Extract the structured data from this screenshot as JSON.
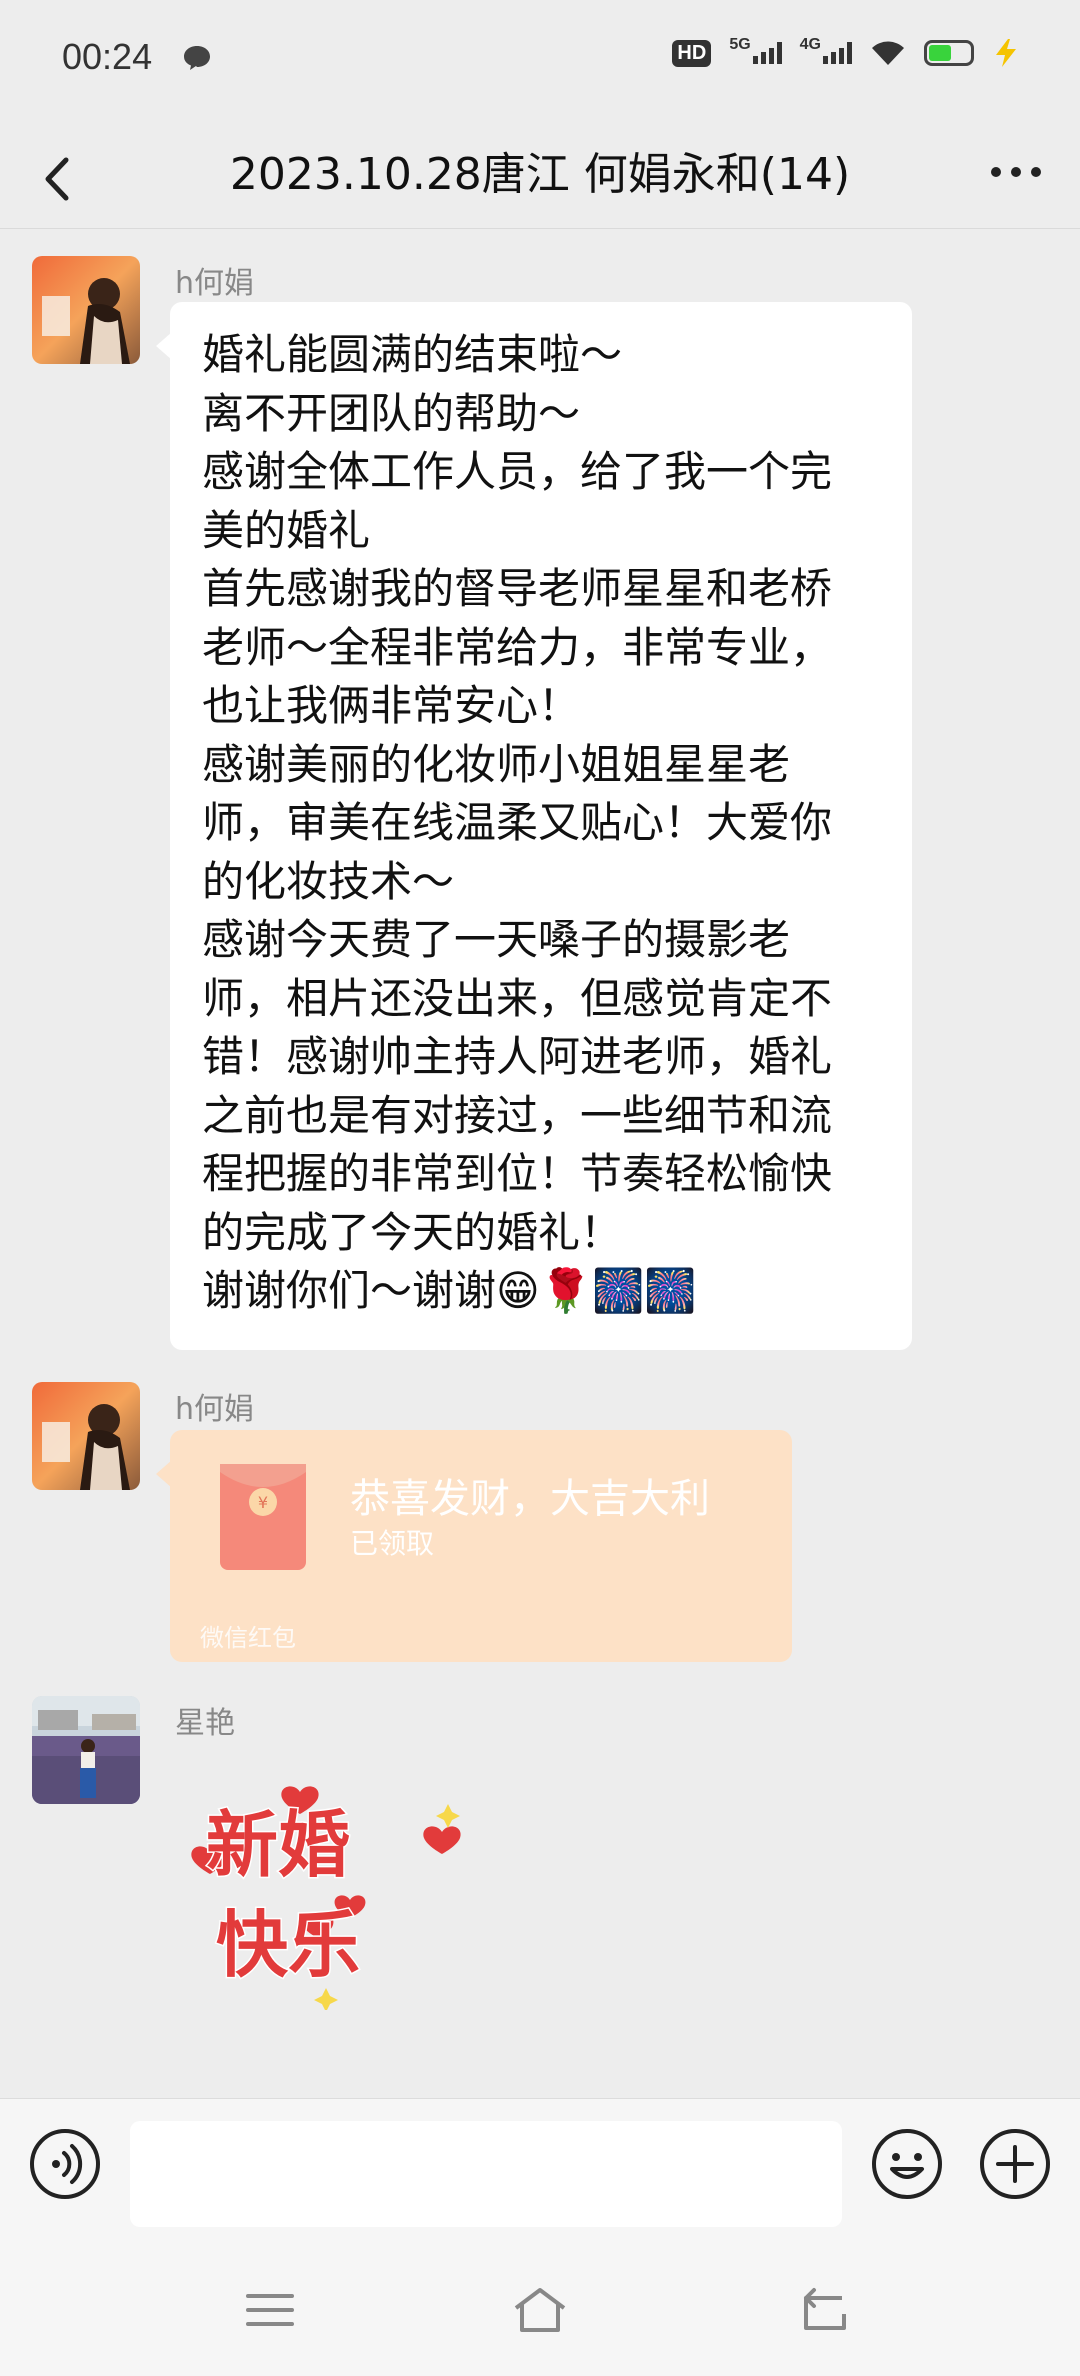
{
  "status_bar": {
    "time": "00:24",
    "hd_label": "HD",
    "net1_label": "5G",
    "net2_label": "4G"
  },
  "header": {
    "title": "2023.10.28唐江 何娟永和(14)"
  },
  "messages": [
    {
      "sender": "h何娟",
      "type": "text",
      "lines": [
        "婚礼能圆满的结束啦～",
        "离不开团队的帮助～",
        "感谢全体工作人员，给了我一个完",
        "美的婚礼",
        "首先感谢我的督导老师星星和老桥",
        "老师～全程非常给力，非常专业，",
        "也让我俩非常安心！",
        "感谢美丽的化妆师小姐姐星星老",
        "师，审美在线温柔又贴心！大爱你",
        "的化妆技术～",
        "感谢今天费了一天嗓子的摄影老",
        "师，相片还没出来，但感觉肯定不",
        "错！感谢帅主持人阿进老师，婚礼",
        "之前也是有对接过，一些细节和流",
        "程把握的非常到位！节奏轻松愉快",
        "的完成了今天的婚礼！",
        "谢谢你们～谢谢😁🌹🎆🎆"
      ]
    },
    {
      "sender": "h何娟",
      "type": "red_packet",
      "title": "恭喜发财，大吉大利",
      "status": "已领取",
      "label": "微信红包",
      "coin_symbol": "¥"
    },
    {
      "sender": "星艳",
      "type": "sticker",
      "sticker_text_top": "新婚",
      "sticker_text_bottom": "快乐"
    }
  ],
  "input_bar": {
    "placeholder": ""
  },
  "colors": {
    "background": "#ededed",
    "bubble": "#ffffff",
    "red_packet": "#fde1c6",
    "sticker_red": "#e23b3b"
  },
  "icons": [
    "chat-bubble-icon",
    "signal-icon",
    "wifi-icon",
    "battery-icon",
    "charging-icon",
    "back-arrow-icon",
    "more-icon",
    "voice-icon",
    "emoji-icon",
    "plus-icon",
    "menu-icon",
    "home-icon",
    "back-nav-icon"
  ]
}
